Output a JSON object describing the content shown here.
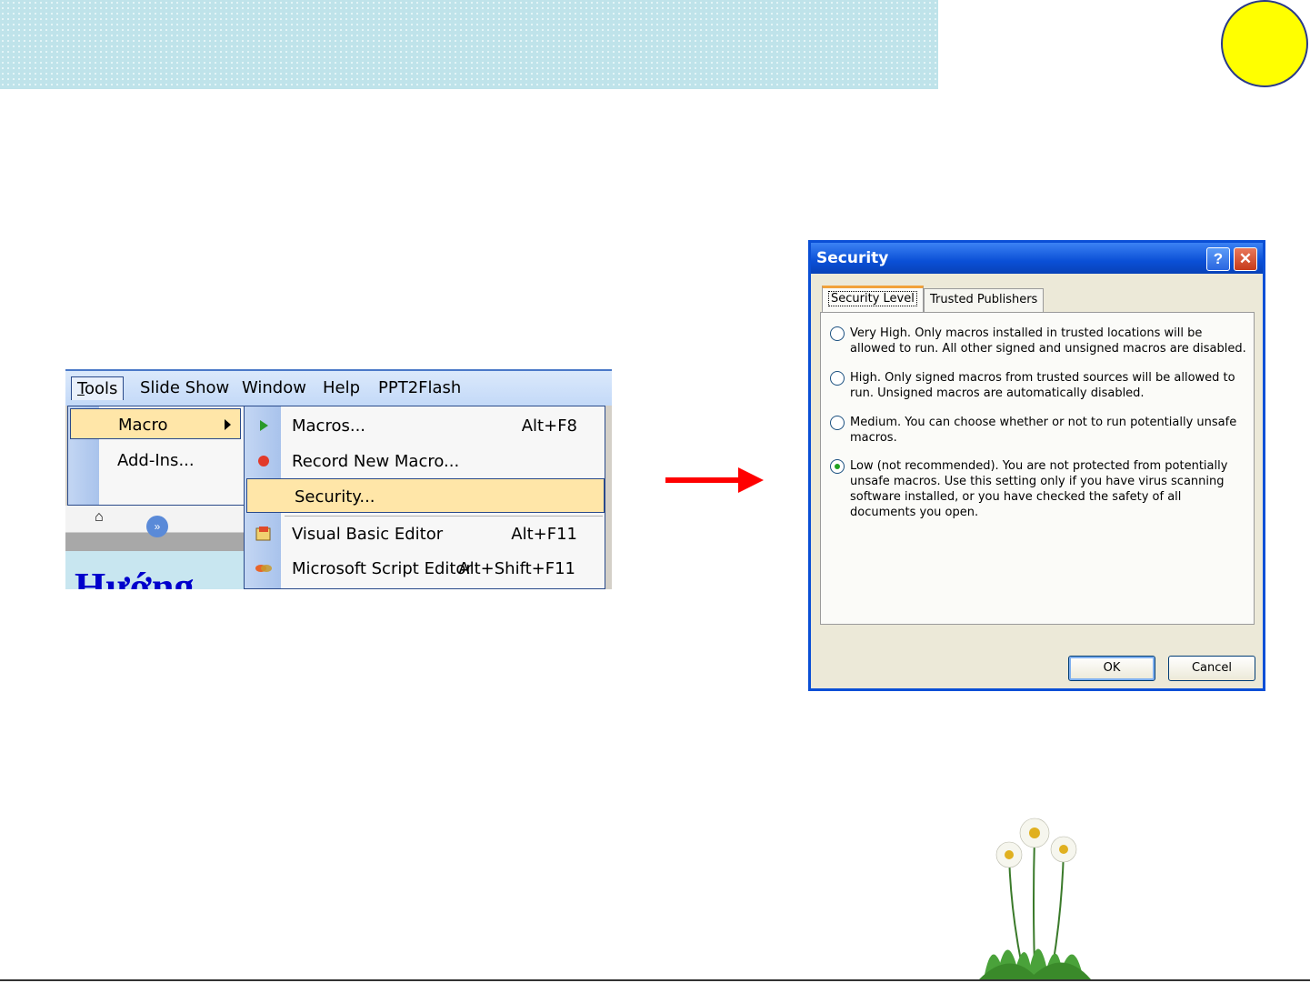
{
  "menu": {
    "menubar": [
      "Tools",
      "Slide Show",
      "Window",
      "Help",
      "PPT2Flash"
    ],
    "tools_menu": {
      "macro": "Macro",
      "addins": "Add-Ins..."
    },
    "macro_submenu": [
      {
        "label": "Macros...",
        "shortcut": "Alt+F8"
      },
      {
        "label": "Record New Macro...",
        "shortcut": ""
      },
      {
        "label": "Security...",
        "shortcut": ""
      },
      {
        "label": "Visual Basic Editor",
        "shortcut": "Alt+F11"
      },
      {
        "label": "Microsoft Script Editor",
        "shortcut": "Alt+Shift+F11"
      }
    ],
    "slide_text": "Hướng"
  },
  "dialog": {
    "title": "Security",
    "help_glyph": "?",
    "close_glyph": "✕",
    "tabs": [
      "Security Level",
      "Trusted Publishers"
    ],
    "options": [
      {
        "label": "Very High. Only macros installed in trusted locations will be allowed to run. All other signed and unsigned macros are disabled.",
        "selected": false
      },
      {
        "label": "High. Only signed macros from trusted sources will be allowed to run. Unsigned macros are automatically disabled.",
        "selected": false
      },
      {
        "label": "Medium. You can choose whether or not to run potentially unsafe macros.",
        "selected": false
      },
      {
        "label": "Low (not recommended). You are not protected from potentially unsafe macros. Use this setting only if you have virus scanning software installed, or you have checked the safety of all documents you open.",
        "selected": true
      }
    ],
    "ok_label": "OK",
    "cancel_label": "Cancel"
  },
  "colors": {
    "header_band": "#bfe3ea",
    "sun": "#ffff00",
    "arrow": "#ff0000",
    "titlebar": "#0a4fd6"
  }
}
